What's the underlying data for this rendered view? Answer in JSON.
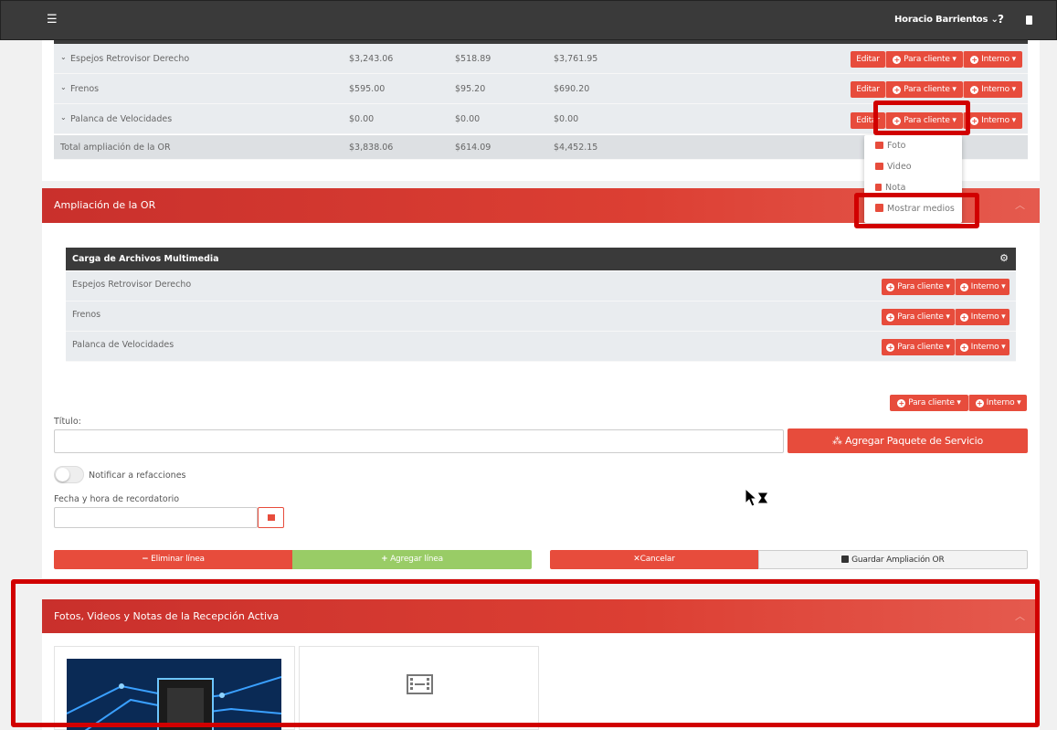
{
  "topbar": {
    "menu_icon": "☰",
    "user_name": "Horacio Barrientos",
    "user_caret": "⌄",
    "help_icon": "?"
  },
  "top_table": {
    "rows": [
      {
        "name": "Espejos Retrovisor Derecho",
        "v1": "$3,243.06",
        "v2": "$518.89",
        "v3": "$3,761.95"
      },
      {
        "name": "Frenos",
        "v1": "$595.00",
        "v2": "$95.20",
        "v3": "$690.20"
      },
      {
        "name": "Palanca de Velocidades",
        "v1": "$0.00",
        "v2": "$0.00",
        "v3": "$0.00"
      }
    ],
    "total": {
      "name": "Total ampliación de la OR",
      "v1": "$3,838.06",
      "v2": "$614.09",
      "v3": "$4,452.15"
    },
    "edit_label": "Editar",
    "para_cliente_label": "Para cliente",
    "interno_label": "Interno",
    "caret": "▾"
  },
  "dropdown": {
    "items": [
      "Foto",
      "Video",
      "Nota",
      "Mostrar medios"
    ]
  },
  "ampliacion": {
    "title": "Ampliación de la OR",
    "collapse_icon": "︿",
    "media_title": "Carga de Archivos Multimedia",
    "media_rows": [
      "Espejos Retrovisor Derecho",
      "Frenos",
      "Palanca de Velocidades"
    ],
    "titulo_label": "Título:",
    "titulo_value": "",
    "paquete_label": "Agregar Paquete de Servicio",
    "notificar_label": "Notificar a refacciones",
    "fecha_label": "Fecha y hora de recordatorio",
    "fecha_value": "",
    "eliminar_label": "Eliminar línea",
    "agregar_label": "Agregar línea",
    "cancelar_label": "Cancelar",
    "guardar_label": "Guardar Ampliación OR"
  },
  "recepcion": {
    "title": "Fotos, Videos y Notas de la Recepción Activa",
    "collapse_icon": "︿"
  },
  "colors": {
    "accent": "#e74c3c",
    "header_red": "#c9302c",
    "green": "#99cc66",
    "dark": "#3a3a3a"
  }
}
